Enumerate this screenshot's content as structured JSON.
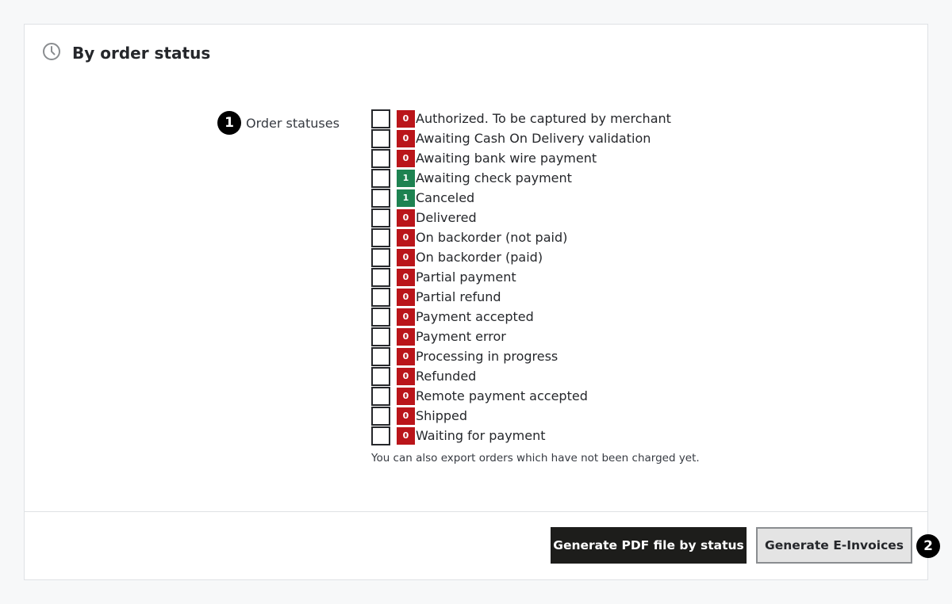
{
  "header": {
    "title": "By order status",
    "icon": "clock-icon"
  },
  "form": {
    "badge_number": "1",
    "label": "Order statuses",
    "statuses": [
      {
        "count": "0",
        "label": "Authorized. To be captured by merchant"
      },
      {
        "count": "0",
        "label": "Awaiting Cash On Delivery validation"
      },
      {
        "count": "0",
        "label": "Awaiting bank wire payment"
      },
      {
        "count": "1",
        "label": "Awaiting check payment"
      },
      {
        "count": "1",
        "label": "Canceled"
      },
      {
        "count": "0",
        "label": "Delivered"
      },
      {
        "count": "0",
        "label": "On backorder (not paid)"
      },
      {
        "count": "0",
        "label": "On backorder (paid)"
      },
      {
        "count": "0",
        "label": "Partial payment"
      },
      {
        "count": "0",
        "label": "Partial refund"
      },
      {
        "count": "0",
        "label": "Payment accepted"
      },
      {
        "count": "0",
        "label": "Payment error"
      },
      {
        "count": "0",
        "label": "Processing in progress"
      },
      {
        "count": "0",
        "label": "Refunded"
      },
      {
        "count": "0",
        "label": "Remote payment accepted"
      },
      {
        "count": "0",
        "label": "Shipped"
      },
      {
        "count": "0",
        "label": "Waiting for payment"
      }
    ],
    "help_text": "You can also export orders which have not been charged yet."
  },
  "footer": {
    "generate_pdf_label": "Generate PDF file by status",
    "generate_einvoices_label": "Generate E-Invoices",
    "badge_number": "2"
  },
  "colors": {
    "count_zero": "#ba151a",
    "count_positive": "#1e8251",
    "primary_button": "#1d1d1b"
  }
}
